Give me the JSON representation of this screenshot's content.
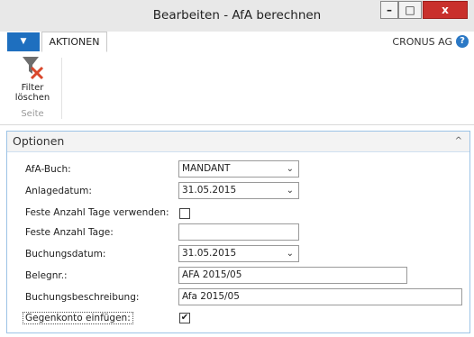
{
  "window": {
    "title": "Bearbeiten - AfA berechnen",
    "min_glyph": "–",
    "max_glyph": "□",
    "close_glyph": "x"
  },
  "ribbon": {
    "app_menu_glyph": "▼",
    "tab_label": "AKTIONEN",
    "company": "CRONUS AG",
    "help_glyph": "?",
    "filter_button_line1": "Filter",
    "filter_button_line2": "löschen",
    "group_label": "Seite"
  },
  "panel": {
    "title": "Optionen",
    "collapse_glyph": "^",
    "fields": {
      "afa_buch": {
        "label": "AfA-Buch:",
        "value": "MANDANT"
      },
      "anlagedatum": {
        "label": "Anlagedatum:",
        "value": "31.05.2015"
      },
      "feste_tage_verwenden": {
        "label": "Feste Anzahl Tage verwenden:",
        "checked_glyph": ""
      },
      "feste_tage": {
        "label": "Feste Anzahl Tage:",
        "value": ""
      },
      "buchungsdatum": {
        "label": "Buchungsdatum:",
        "value": "31.05.2015"
      },
      "belegnr": {
        "label": "Belegnr.:",
        "value": "AFA 2015/05"
      },
      "buchungsbeschreibung": {
        "label": "Buchungsbeschreibung:",
        "value": "Afa 2015/05"
      },
      "gegenkonto": {
        "label": "Gegenkonto einfügen:",
        "checked_glyph": "✔"
      }
    },
    "dropdown_glyph": "⌄"
  },
  "colors": {
    "accent": "#1e6fbf",
    "close": "#c9302c",
    "panel_border": "#9cc3e6",
    "filter_x": "#d9472b"
  }
}
